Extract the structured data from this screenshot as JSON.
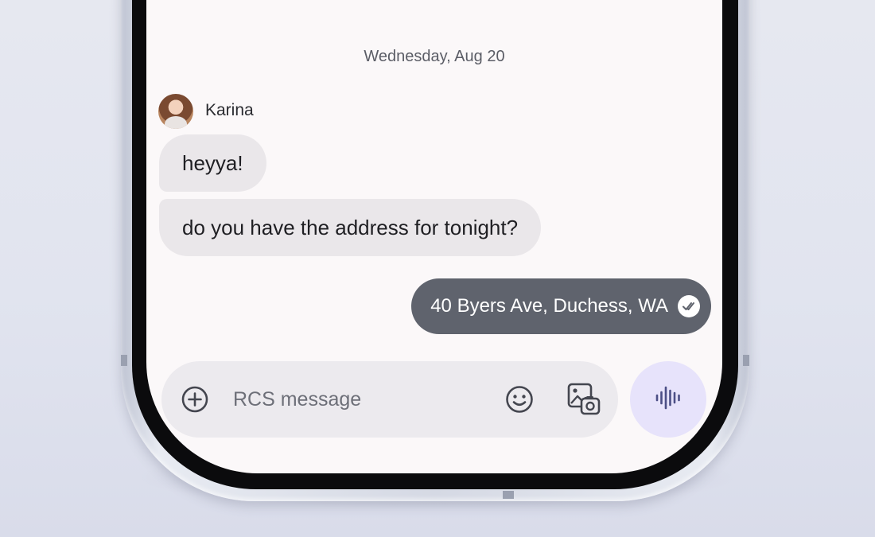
{
  "conversation": {
    "date_header": "Wednesday, Aug 20",
    "contact": {
      "name": "Karina"
    }
  },
  "messages": [
    {
      "direction": "incoming",
      "text": "heyya!"
    },
    {
      "direction": "incoming",
      "text": "do you have the address for tonight?"
    },
    {
      "direction": "outgoing",
      "text": "40 Byers Ave, Duchess, WA",
      "status_icon": "read-receipt-icon"
    }
  ],
  "compose": {
    "placeholder": "RCS message",
    "value": "",
    "icons": [
      "add-icon",
      "emoji-icon",
      "gallery-icon",
      "voice-message-icon"
    ]
  },
  "colors": {
    "outgoing_bubble": "#5f636d",
    "incoming_bubble": "#eae7ea",
    "voice_button": "#e7e3fb",
    "screen_background": "#fbf8f9"
  }
}
